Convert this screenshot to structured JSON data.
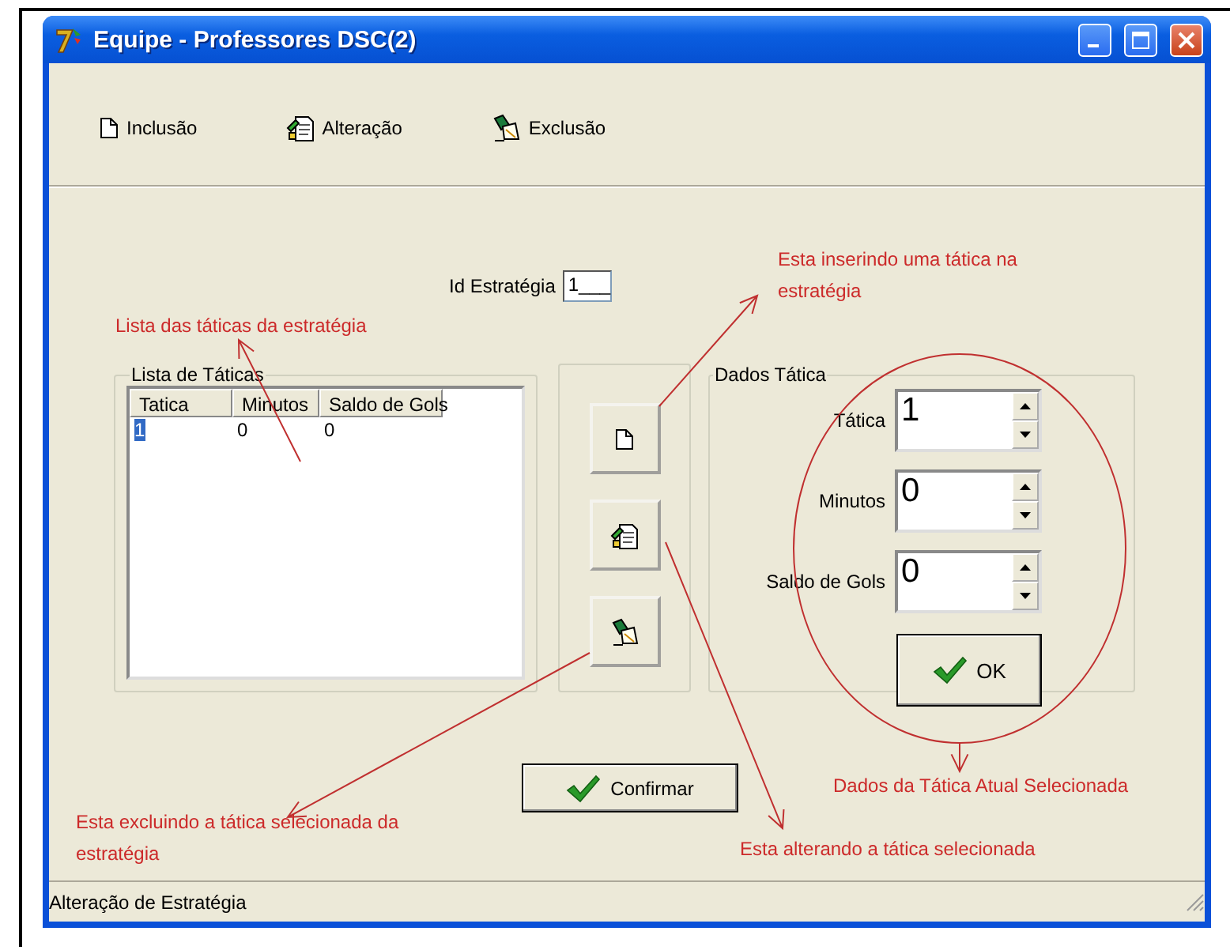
{
  "window": {
    "title": "Equipe - Professores DSC(2)"
  },
  "toolbar": [
    {
      "label": "Inclusão",
      "kind": "new"
    },
    {
      "label": "Alteração",
      "kind": "edit"
    },
    {
      "label": "Exclusão",
      "kind": "delete"
    }
  ],
  "id_field": {
    "label": "Id Estratégia",
    "value": "1___"
  },
  "list_group": {
    "title": "Lista de Táticas",
    "columns": [
      "Tatica",
      "Minutos",
      "Saldo de Gols"
    ],
    "rows": [
      {
        "cells": [
          "1",
          "0",
          "0"
        ],
        "selected": true
      }
    ]
  },
  "side_buttons": [
    {
      "kind": "new"
    },
    {
      "kind": "edit"
    },
    {
      "kind": "delete"
    }
  ],
  "data_group": {
    "title": "Dados Tática",
    "fields": [
      {
        "label": "Tática",
        "value": "1"
      },
      {
        "label": "Minutos",
        "value": "0"
      },
      {
        "label": "Saldo de Gols",
        "value": "0"
      }
    ],
    "ok_button": "OK"
  },
  "confirm_button": "Confirmar",
  "status_bar": "Alteração de Estratégia",
  "annotations": [
    {
      "text": "Lista das táticas da estratégia"
    },
    {
      "text": "Esta inserindo uma tática na estratégia"
    },
    {
      "text": "Esta excluindo a tática selecionada da estratégia"
    },
    {
      "text": "Esta alterando a tática selecionada"
    },
    {
      "text": "Dados da Tática Atual Selecionada"
    }
  ]
}
